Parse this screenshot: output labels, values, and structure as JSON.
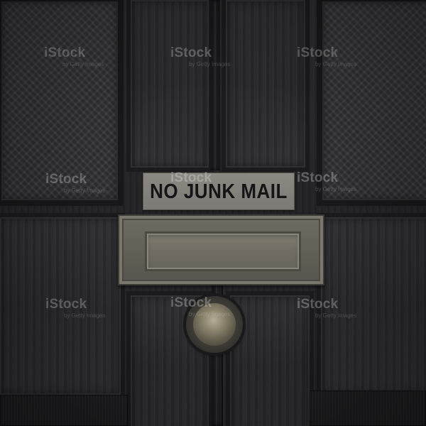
{
  "photo": {
    "sign_text": "NO JUNK MAIL",
    "watermark_text": "iStock",
    "watermark_subtext": "by Getty Images"
  }
}
